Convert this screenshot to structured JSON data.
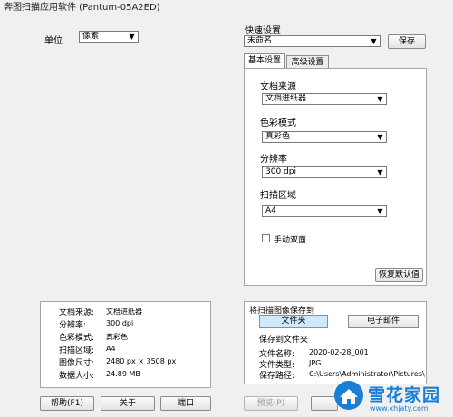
{
  "window": {
    "title": "奔图扫描应用软件 (Pantum-05A2ED)"
  },
  "unit": {
    "label": "单位",
    "value": "像素"
  },
  "quick_settings": {
    "label": "快速设置",
    "value": "未命名",
    "save_label": "保存"
  },
  "tabs": [
    {
      "label": "基本设置",
      "active": true
    },
    {
      "label": "高级设置",
      "active": false
    }
  ],
  "basic": {
    "source_label": "文档来源",
    "source_value": "文档进纸器",
    "color_label": "色彩模式",
    "color_value": "真彩色",
    "resolution_label": "分辨率",
    "resolution_value": "300 dpi",
    "area_label": "扫描区域",
    "area_value": "A4",
    "duplex_label": "手动双面",
    "duplex_checked": false,
    "restore_label": "恢复默认值"
  },
  "summary": [
    {
      "label": "文档来源:",
      "value": "文档进纸器"
    },
    {
      "label": "分辨率:",
      "value": "300 dpi"
    },
    {
      "label": "色彩模式:",
      "value": "真彩色"
    },
    {
      "label": "扫描区域:",
      "value": "A4"
    },
    {
      "label": "图像尺寸:",
      "value": "2480 px × 3508 px"
    },
    {
      "label": "数据大小:",
      "value": "24.89 MB"
    }
  ],
  "save_target": {
    "title": "将扫描图像保存到",
    "folder_label": "文件夹",
    "email_label": "电子邮件",
    "subtitle": "保存到文件夹",
    "file_name_label": "文件名称:",
    "file_name_value": "2020-02-28_001",
    "file_type_label": "文件类型:",
    "file_type_value": "JPG",
    "save_path_label": "保存路径:",
    "save_path_value": "C:\\Users\\Administrator\\Pictures\\"
  },
  "buttons": {
    "help": "帮助(F1)",
    "about": "关于",
    "port": "端口",
    "preview": "预览(P)"
  },
  "watermark": {
    "text": "雪花家园",
    "url": "www.xhjaty.com"
  },
  "colors": {
    "folder_selected": "#cfe8fb",
    "watermark_blue": "#1a7fd4"
  }
}
